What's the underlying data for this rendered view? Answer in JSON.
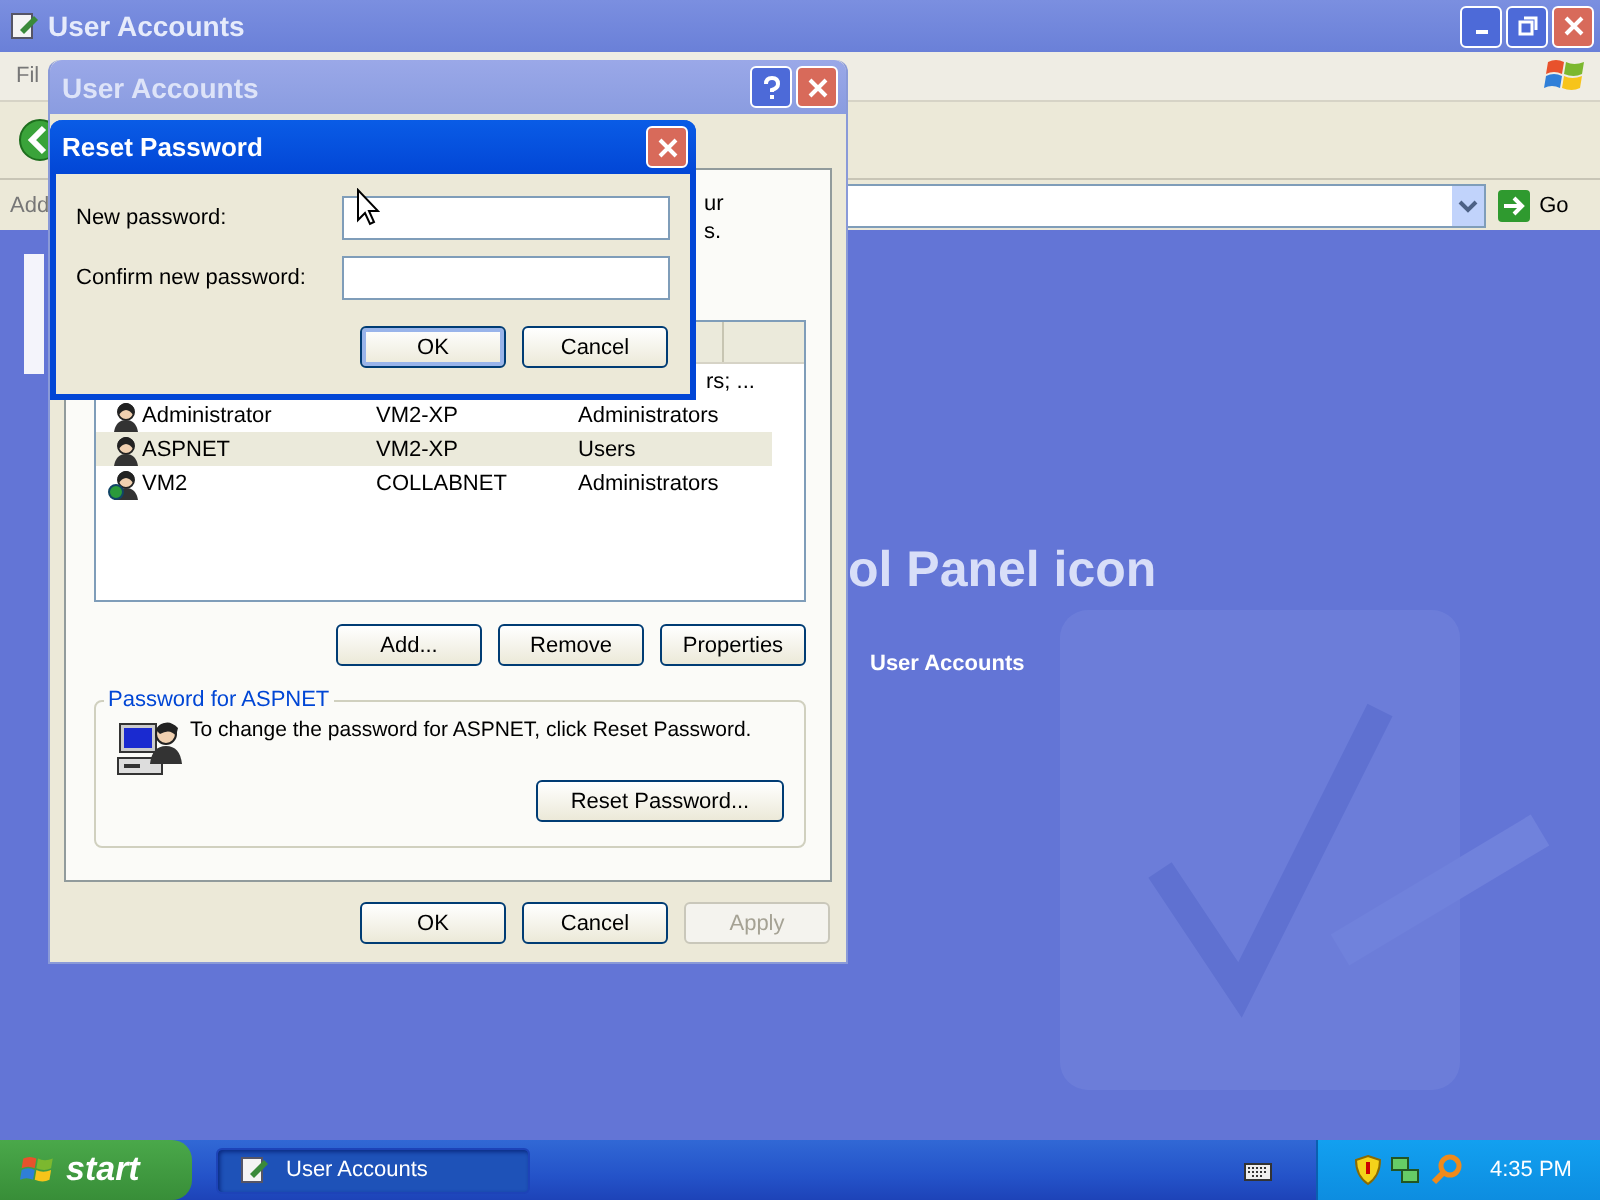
{
  "main_window": {
    "title": "User Accounts",
    "menu_bar": {
      "items": [
        "Fil"
      ]
    },
    "address_bar": {
      "label": "Add",
      "go_button": "Go"
    },
    "content": {
      "heading": "ol Panel icon",
      "link": "User Accounts"
    }
  },
  "user_accounts_dialog": {
    "title": "User Accounts",
    "intro_fragments": [
      "ur",
      "s."
    ],
    "partial_row": {
      "group": "rs; ..."
    },
    "users": [
      {
        "name": "Administrator",
        "domain": "VM2-XP",
        "group": "Administrators",
        "kind": "local",
        "selected": false
      },
      {
        "name": "ASPNET",
        "domain": "VM2-XP",
        "group": "Users",
        "kind": "local",
        "selected": true
      },
      {
        "name": "VM2",
        "domain": "COLLABNET",
        "group": "Administrators",
        "kind": "domain",
        "selected": false
      }
    ],
    "list_buttons": [
      "Add...",
      "Remove",
      "Properties"
    ],
    "password_group": {
      "title": "Password for ASPNET",
      "message": "To change the password for ASPNET, click Reset Password.",
      "button": "Reset Password..."
    },
    "buttons": [
      {
        "label": "OK",
        "disabled": false
      },
      {
        "label": "Cancel",
        "disabled": false
      },
      {
        "label": "Apply",
        "disabled": true
      }
    ]
  },
  "reset_password_dialog": {
    "title": "Reset Password",
    "fields": [
      {
        "label": "New password:"
      },
      {
        "label": "Confirm new password:"
      }
    ],
    "buttons": [
      {
        "label": "OK",
        "default": true
      },
      {
        "label": "Cancel",
        "default": false
      }
    ]
  },
  "taskbar": {
    "start": "start",
    "tasks": [
      {
        "label": "User Accounts",
        "selected": true
      }
    ],
    "clock": "4:35 PM"
  }
}
